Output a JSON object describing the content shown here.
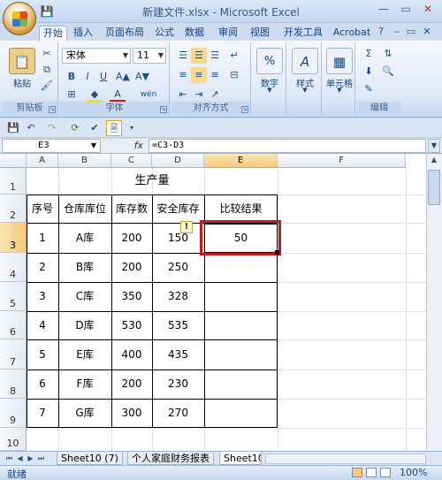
{
  "window": {
    "title": "新建文件.xlsx - Microsoft Excel",
    "minimize_icon": "minimize-icon",
    "maximize_icon": "maximize-icon",
    "close_icon": "close-icon"
  },
  "ribbon_tabs": [
    "开始",
    "插入",
    "页面布局",
    "公式",
    "数据",
    "审阅",
    "视图",
    "开发工具",
    "Acrobat"
  ],
  "active_tab": "开始",
  "ribbon": {
    "clipboard": {
      "paste_label": "粘贴",
      "group_label": "剪贴板"
    },
    "font": {
      "font_name": "宋体",
      "font_size": "11",
      "group_label": "字体",
      "bold": "B",
      "italic": "I",
      "underline": "U",
      "font_color_sample": "A",
      "phonetic_label": "wén"
    },
    "alignment": {
      "group_label": "对齐方式"
    },
    "number": {
      "label": "数字",
      "icon_text": "%"
    },
    "styles": {
      "label": "样式",
      "icon_text": "A"
    },
    "cells": {
      "label": "单元格"
    },
    "editing": {
      "group_label": "编辑"
    }
  },
  "formula_bar": {
    "name_box": "E3",
    "fx": "fx",
    "formula": "=C3-D3"
  },
  "columns": [
    "A",
    "B",
    "C",
    "D",
    "E",
    "F"
  ],
  "selected_column": "E",
  "rows": [
    "1",
    "2",
    "3",
    "4",
    "5",
    "6",
    "7",
    "8",
    "9",
    "10"
  ],
  "selected_row": "3",
  "table": {
    "title": "生产量",
    "headers": [
      "序号",
      "仓库库位",
      "库存数",
      "安全库存",
      "比较结果"
    ],
    "rows": [
      [
        "1",
        "A库",
        "200",
        "150",
        "50"
      ],
      [
        "2",
        "B库",
        "200",
        "250",
        ""
      ],
      [
        "3",
        "C库",
        "350",
        "328",
        ""
      ],
      [
        "4",
        "D库",
        "530",
        "535",
        ""
      ],
      [
        "5",
        "E库",
        "400",
        "435",
        ""
      ],
      [
        "6",
        "F库",
        "200",
        "230",
        ""
      ],
      [
        "7",
        "G库",
        "300",
        "270",
        ""
      ]
    ]
  },
  "sheet_tabs": [
    "Sheet10 (7)",
    "个人家庭财务报表",
    "Sheet10"
  ],
  "active_sheet": "Sheet10",
  "status": {
    "ready": "就绪",
    "zoom": "100%"
  },
  "colors": {
    "highlight_border": "#c8191d",
    "selection_header": "#f7c97a",
    "ribbon_bg": "#dfe9f7"
  }
}
